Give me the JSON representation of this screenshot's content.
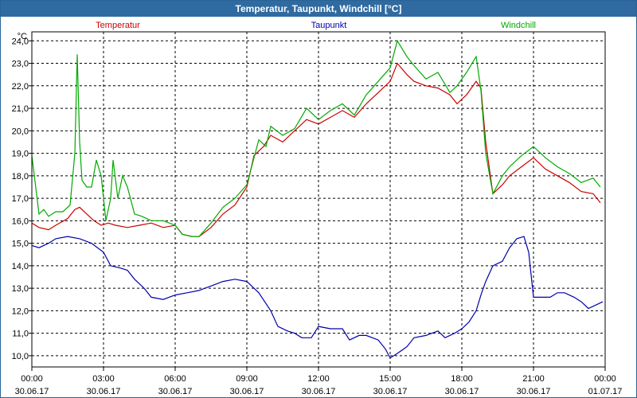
{
  "window": {
    "title": "Temperatur, Taupunkt, Windchill [°C]"
  },
  "chart_data": {
    "type": "line",
    "title": "Temperatur, Taupunkt, Windchill [°C]",
    "ylabel": "°C",
    "ylim": [
      9.5,
      24.4
    ],
    "yticks": [
      "10,0",
      "11,0",
      "12,0",
      "13,0",
      "14,0",
      "15,0",
      "16,0",
      "17,0",
      "18,0",
      "19,0",
      "20,0",
      "21,0",
      "22,0",
      "23,0",
      "24,0"
    ],
    "xlim": [
      0,
      24
    ],
    "xticks": [
      {
        "time": "00:00",
        "date": "30.06.17"
      },
      {
        "time": "03:00",
        "date": "30.06.17"
      },
      {
        "time": "06:00",
        "date": "30.06.17"
      },
      {
        "time": "09:00",
        "date": "30.06.17"
      },
      {
        "time": "12:00",
        "date": "30.06.17"
      },
      {
        "time": "15:00",
        "date": "30.06.17"
      },
      {
        "time": "18:00",
        "date": "30.06.17"
      },
      {
        "time": "21:00",
        "date": "30.06.17"
      },
      {
        "time": "00:00",
        "date": "01.07.17"
      }
    ],
    "grid": true,
    "legend_position": "top",
    "series": [
      {
        "name": "Temperatur",
        "color": "#cc0000",
        "points": [
          [
            0,
            15.9
          ],
          [
            0.3,
            15.7
          ],
          [
            0.7,
            15.6
          ],
          [
            1,
            15.8
          ],
          [
            1.5,
            16.1
          ],
          [
            1.8,
            16.5
          ],
          [
            2,
            16.6
          ],
          [
            2.3,
            16.3
          ],
          [
            2.6,
            16.0
          ],
          [
            2.9,
            15.8
          ],
          [
            3.2,
            15.9
          ],
          [
            3.5,
            15.8
          ],
          [
            4,
            15.7
          ],
          [
            4.5,
            15.8
          ],
          [
            5,
            15.9
          ],
          [
            5.5,
            15.7
          ],
          [
            6,
            15.8
          ],
          [
            6.3,
            15.4
          ],
          [
            6.7,
            15.3
          ],
          [
            7,
            15.3
          ],
          [
            7.5,
            15.7
          ],
          [
            8,
            16.3
          ],
          [
            8.5,
            16.7
          ],
          [
            9,
            17.5
          ],
          [
            9.3,
            18.9
          ],
          [
            9.7,
            19.3
          ],
          [
            10,
            19.8
          ],
          [
            10.5,
            19.5
          ],
          [
            11,
            20.0
          ],
          [
            11.5,
            20.5
          ],
          [
            12,
            20.3
          ],
          [
            12.5,
            20.6
          ],
          [
            13,
            20.9
          ],
          [
            13.5,
            20.6
          ],
          [
            14,
            21.2
          ],
          [
            14.5,
            21.7
          ],
          [
            15,
            22.2
          ],
          [
            15.3,
            23.0
          ],
          [
            15.7,
            22.5
          ],
          [
            16,
            22.2
          ],
          [
            16.5,
            22.0
          ],
          [
            17,
            21.9
          ],
          [
            17.5,
            21.6
          ],
          [
            17.8,
            21.2
          ],
          [
            18.2,
            21.6
          ],
          [
            18.6,
            22.2
          ],
          [
            18.8,
            21.9
          ],
          [
            19,
            19.5
          ],
          [
            19.3,
            17.2
          ],
          [
            19.7,
            17.6
          ],
          [
            20,
            18.0
          ],
          [
            20.5,
            18.4
          ],
          [
            21,
            18.8
          ],
          [
            21.5,
            18.3
          ],
          [
            22,
            18.0
          ],
          [
            22.5,
            17.7
          ],
          [
            23,
            17.3
          ],
          [
            23.5,
            17.2
          ],
          [
            23.8,
            16.8
          ]
        ]
      },
      {
        "name": "Taupunkt",
        "color": "#0000aa",
        "points": [
          [
            0,
            14.9
          ],
          [
            0.3,
            14.8
          ],
          [
            0.7,
            15.0
          ],
          [
            1,
            15.2
          ],
          [
            1.5,
            15.3
          ],
          [
            2,
            15.2
          ],
          [
            2.5,
            15.0
          ],
          [
            3,
            14.6
          ],
          [
            3.3,
            14.0
          ],
          [
            3.7,
            13.9
          ],
          [
            4,
            13.8
          ],
          [
            4.3,
            13.4
          ],
          [
            4.7,
            13.0
          ],
          [
            5,
            12.6
          ],
          [
            5.5,
            12.5
          ],
          [
            6,
            12.7
          ],
          [
            6.5,
            12.8
          ],
          [
            7,
            12.9
          ],
          [
            7.5,
            13.1
          ],
          [
            8,
            13.3
          ],
          [
            8.5,
            13.4
          ],
          [
            9,
            13.3
          ],
          [
            9.5,
            12.8
          ],
          [
            10,
            12.0
          ],
          [
            10.3,
            11.3
          ],
          [
            10.7,
            11.1
          ],
          [
            11,
            11.0
          ],
          [
            11.3,
            10.8
          ],
          [
            11.7,
            10.8
          ],
          [
            12,
            11.3
          ],
          [
            12.5,
            11.2
          ],
          [
            13,
            11.2
          ],
          [
            13.3,
            10.7
          ],
          [
            13.7,
            10.9
          ],
          [
            14,
            10.9
          ],
          [
            14.5,
            10.7
          ],
          [
            14.8,
            10.3
          ],
          [
            15,
            9.9
          ],
          [
            15.3,
            10.1
          ],
          [
            15.7,
            10.4
          ],
          [
            16,
            10.8
          ],
          [
            16.5,
            10.9
          ],
          [
            17,
            11.1
          ],
          [
            17.3,
            10.8
          ],
          [
            17.7,
            11.0
          ],
          [
            18,
            11.2
          ],
          [
            18.3,
            11.5
          ],
          [
            18.6,
            12.0
          ],
          [
            18.8,
            12.7
          ],
          [
            19,
            13.3
          ],
          [
            19.3,
            14.0
          ],
          [
            19.7,
            14.2
          ],
          [
            20,
            14.8
          ],
          [
            20.3,
            15.2
          ],
          [
            20.6,
            15.3
          ],
          [
            20.8,
            14.6
          ],
          [
            21,
            12.6
          ],
          [
            21.3,
            12.6
          ],
          [
            21.7,
            12.6
          ],
          [
            22,
            12.8
          ],
          [
            22.3,
            12.8
          ],
          [
            22.7,
            12.6
          ],
          [
            23,
            12.4
          ],
          [
            23.3,
            12.1
          ],
          [
            23.7,
            12.3
          ],
          [
            23.9,
            12.4
          ]
        ]
      },
      {
        "name": "Windchill",
        "color": "#00aa00",
        "points": [
          [
            0,
            18.9
          ],
          [
            0.3,
            16.3
          ],
          [
            0.5,
            16.5
          ],
          [
            0.7,
            16.2
          ],
          [
            1,
            16.4
          ],
          [
            1.3,
            16.4
          ],
          [
            1.6,
            16.7
          ],
          [
            1.8,
            19.0
          ],
          [
            1.9,
            23.4
          ],
          [
            2.0,
            19.5
          ],
          [
            2.1,
            17.8
          ],
          [
            2.3,
            17.5
          ],
          [
            2.5,
            17.5
          ],
          [
            2.7,
            18.7
          ],
          [
            2.9,
            18.0
          ],
          [
            3.1,
            16.0
          ],
          [
            3.3,
            17.0
          ],
          [
            3.4,
            18.7
          ],
          [
            3.6,
            17.0
          ],
          [
            3.8,
            18.0
          ],
          [
            4,
            17.5
          ],
          [
            4.3,
            16.3
          ],
          [
            4.6,
            16.2
          ],
          [
            5,
            16.0
          ],
          [
            5.5,
            16.0
          ],
          [
            6,
            15.8
          ],
          [
            6.3,
            15.4
          ],
          [
            6.7,
            15.3
          ],
          [
            7,
            15.3
          ],
          [
            7.5,
            15.9
          ],
          [
            8,
            16.6
          ],
          [
            8.5,
            17.0
          ],
          [
            9,
            17.6
          ],
          [
            9.3,
            18.8
          ],
          [
            9.5,
            19.6
          ],
          [
            9.8,
            19.3
          ],
          [
            10,
            20.2
          ],
          [
            10.5,
            19.8
          ],
          [
            11,
            20.1
          ],
          [
            11.5,
            21.0
          ],
          [
            12,
            20.5
          ],
          [
            12.5,
            20.9
          ],
          [
            13,
            21.2
          ],
          [
            13.5,
            20.7
          ],
          [
            14,
            21.6
          ],
          [
            14.5,
            22.2
          ],
          [
            15,
            22.8
          ],
          [
            15.3,
            24.0
          ],
          [
            15.7,
            23.3
          ],
          [
            16,
            22.9
          ],
          [
            16.5,
            22.3
          ],
          [
            17,
            22.6
          ],
          [
            17.5,
            21.7
          ],
          [
            17.8,
            22.0
          ],
          [
            18.2,
            22.6
          ],
          [
            18.6,
            23.3
          ],
          [
            18.8,
            21.8
          ],
          [
            19,
            19.0
          ],
          [
            19.3,
            17.2
          ],
          [
            19.7,
            18.0
          ],
          [
            20,
            18.4
          ],
          [
            20.5,
            18.9
          ],
          [
            21,
            19.3
          ],
          [
            21.5,
            18.8
          ],
          [
            22,
            18.4
          ],
          [
            22.5,
            18.1
          ],
          [
            23,
            17.7
          ],
          [
            23.5,
            17.9
          ],
          [
            23.8,
            17.5
          ]
        ]
      }
    ]
  }
}
